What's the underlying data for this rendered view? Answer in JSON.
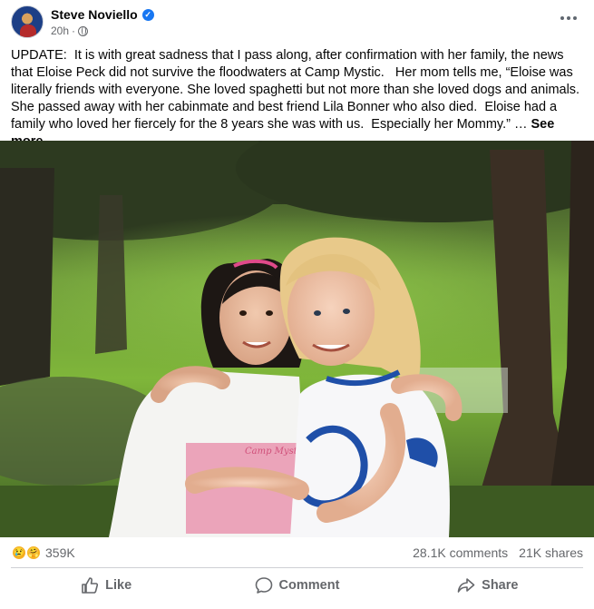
{
  "header": {
    "author": "Steve Noviello",
    "time": "20h",
    "verified_icon": "verified-badge-icon",
    "privacy_icon": "globe-icon",
    "more_icon": "more-options-icon"
  },
  "post": {
    "text": "UPDATE:  It is with great sadness that I pass along, after confirmation with her family, the news that Eloise Peck did not survive the floodwaters at Camp Mystic.   Her mom tells me, “Eloise was literally friends with everyone. She loved spaghetti but not more than she loved dogs and animals.   She passed away with her cabinmate and best friend Lila Bonner who also died.  Eloise had a family who loved her fiercely for the 8 years she was with us.  Especially her Mommy.” …",
    "see_more": "See more",
    "shirt_text_left": "Camp Mystic"
  },
  "stats": {
    "reactions_count": "359K",
    "comments": "28.1K comments",
    "shares": "21K shares"
  },
  "actions": {
    "like": "Like",
    "comment": "Comment",
    "share": "Share"
  },
  "colors": {
    "brand_blue": "#1877f2",
    "secondary_text": "#65676b",
    "divider": "#ced0d4"
  }
}
